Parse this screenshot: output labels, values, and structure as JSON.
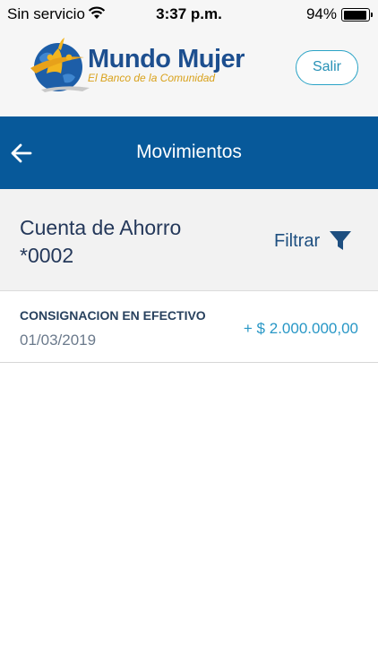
{
  "status_bar": {
    "carrier": "Sin servicio",
    "time": "3:37 p.m.",
    "battery_percent": "94%",
    "battery_level": 0.94,
    "icons": [
      "wifi-icon",
      "battery-icon"
    ]
  },
  "header": {
    "brand_name": "Mundo Mujer",
    "brand_tagline": "El Banco de la Comunidad",
    "logout_label": "Salir"
  },
  "nav": {
    "title": "Movimientos",
    "back_icon": "arrow-left-icon"
  },
  "account": {
    "title_line1": "Cuenta de Ahorro",
    "title_line2": "*0002",
    "filter_label": "Filtrar",
    "filter_icon": "funnel-icon"
  },
  "transactions": [
    {
      "description": "CONSIGNACION EN EFECTIVO",
      "date": "01/03/2019",
      "amount": "+  $ 2.000.000,00"
    }
  ],
  "colors": {
    "nav_background": "#07599a",
    "brand_blue": "#1d4f8f",
    "brand_gold": "#d9a21c",
    "accent": "#2897c6"
  }
}
